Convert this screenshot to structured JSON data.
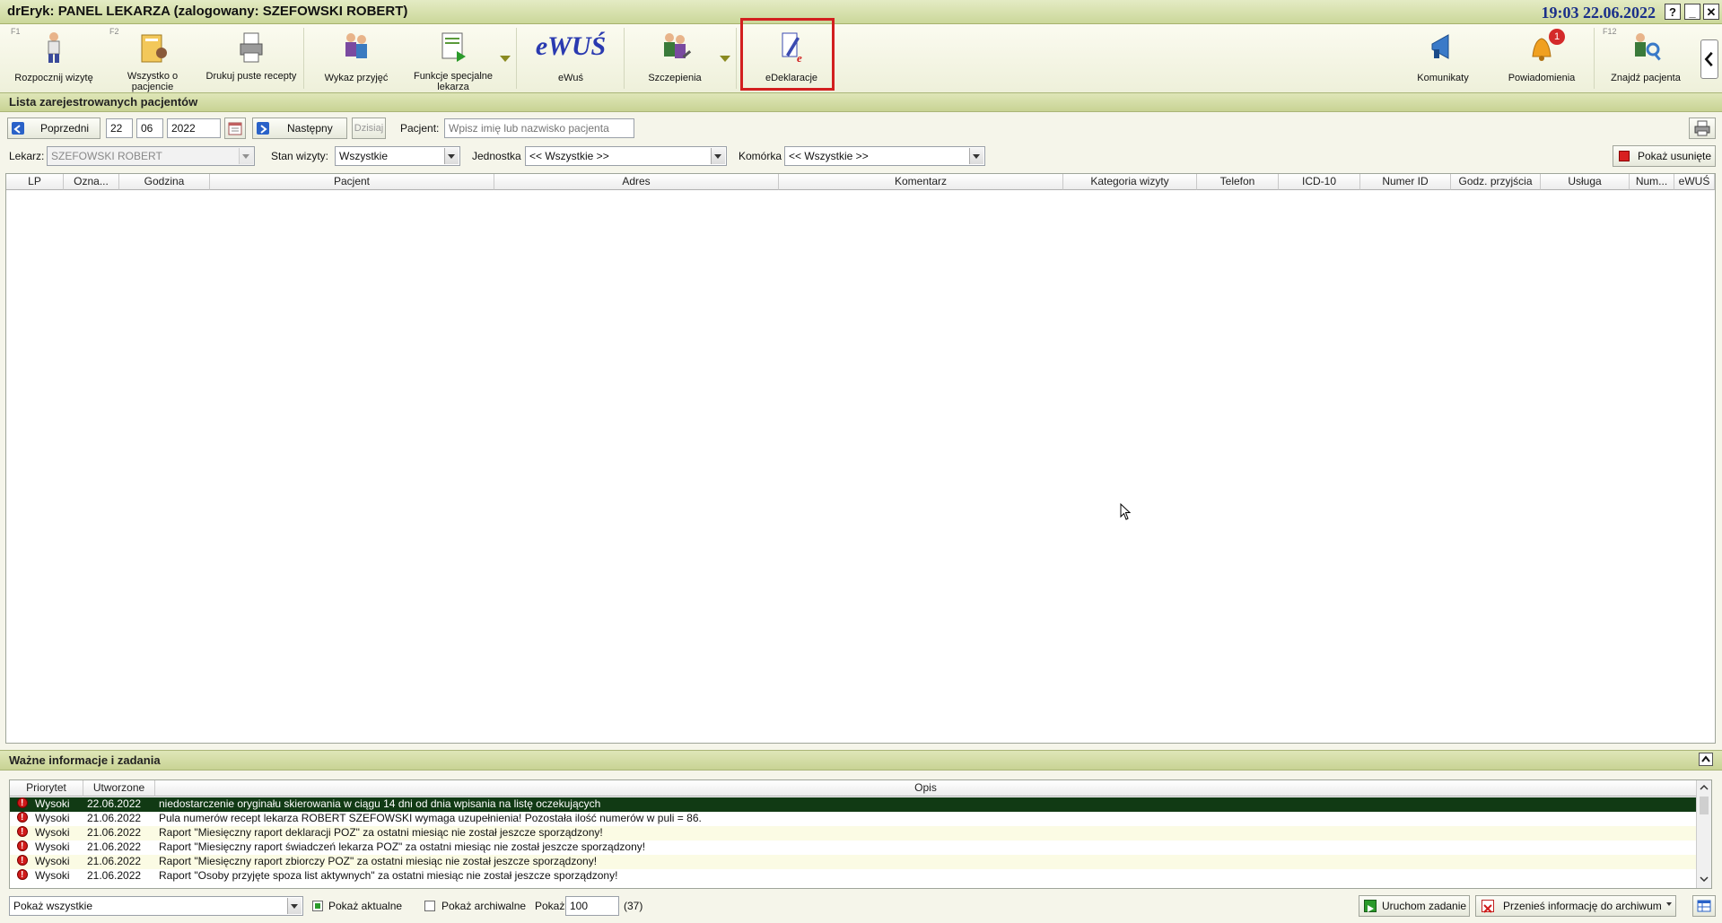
{
  "window": {
    "title": "drEryk: PANEL LEKARZA (zalogowany: SZEFOWSKI ROBERT)",
    "clock": "19:03 22.06.2022",
    "help_label": "?",
    "minimize_label": "_",
    "close_label": "✕"
  },
  "toolbar": {
    "start_visit": {
      "key": "F1",
      "label": "Rozpocznij wizytę"
    },
    "patient_info": {
      "key": "F2",
      "label": "Wszystko o pacjencie"
    },
    "print_blank": {
      "label": "Drukuj puste recepty"
    },
    "admissions": {
      "label": "Wykaz przyjęć"
    },
    "special_functions": {
      "label": "Funkcje specjalne lekarza"
    },
    "ewus": {
      "logo": "eWUŚ",
      "label": "eWuś"
    },
    "vaccinations": {
      "label": "Szczepienia"
    },
    "edeclarations": {
      "label": "eDeklaracje"
    },
    "messages": {
      "label": "Komunikaty"
    },
    "notifications": {
      "label": "Powiadomienia",
      "badge": "1"
    },
    "find_patient": {
      "key": "F12",
      "label": "Znajdź pacjenta"
    }
  },
  "patients_section": {
    "title": "Lista zarejestrowanych pacjentów",
    "prev_label": "Poprzedni",
    "day": "22",
    "month": "06",
    "year": "2022",
    "next_label": "Następny",
    "today_label": "Dzisiaj",
    "patient_label": "Pacjent:",
    "patient_placeholder": "Wpisz imię lub nazwisko pacjenta",
    "doctor_label": "Lekarz:",
    "doctor_value": "SZEFOWSKI ROBERT",
    "visit_state_label": "Stan wizyty:",
    "visit_state_value": "Wszystkie",
    "unit_label": "Jednostka",
    "unit_value": "<< Wszystkie >>",
    "cell_label": "Komórka",
    "cell_value": "<< Wszystkie >>",
    "show_deleted_label": "Pokaż usunięte",
    "columns": [
      "LP",
      "Ozna...",
      "Godzina",
      "Pacjent",
      "Adres",
      "Komentarz",
      "Kategoria wizyty",
      "Telefon",
      "ICD-10",
      "Numer ID",
      "Godz. przyjścia",
      "Usługa",
      "Num...",
      "eWUŚ"
    ]
  },
  "info_section": {
    "title": "Ważne informacje i zadania",
    "columns": [
      "Priorytet",
      "Utworzone",
      "Opis"
    ],
    "rows": [
      {
        "priority": "Wysoki",
        "created": "22.06.2022",
        "desc": "niedostarczenie oryginału skierowania w ciągu 14 dni od dnia wpisania na listę oczekujących"
      },
      {
        "priority": "Wysoki",
        "created": "21.06.2022",
        "desc": "Pula numerów recept lekarza ROBERT SZEFOWSKI wymaga uzupełnienia! Pozostała ilość numerów w puli = 86."
      },
      {
        "priority": "Wysoki",
        "created": "21.06.2022",
        "desc": "Raport \"Miesięczny raport deklaracji POZ\" za ostatni miesiąc nie został jeszcze sporządzony!"
      },
      {
        "priority": "Wysoki",
        "created": "21.06.2022",
        "desc": "Raport \"Miesięczny raport świadczeń lekarza POZ\" za ostatni miesiąc nie został jeszcze sporządzony!"
      },
      {
        "priority": "Wysoki",
        "created": "21.06.2022",
        "desc": "Raport \"Miesięczny raport zbiorczy POZ\" za ostatni miesiąc nie został jeszcze sporządzony!"
      },
      {
        "priority": "Wysoki",
        "created": "21.06.2022",
        "desc": "Raport \"Osoby przyjęte spoza list aktywnych\" za ostatni miesiąc nie został jeszcze sporządzony!"
      }
    ],
    "filter_value": "Pokaż wszystkie",
    "show_current_label": "Pokaż aktualne",
    "show_archived_label": "Pokaż archiwalne",
    "show_label": "Pokaż",
    "show_count": "100",
    "total": "(37)",
    "run_task_label": "Uruchom zadanie",
    "archive_label": "Przenieś informację do archiwum"
  },
  "colors": {
    "accent_green": "#c8d394",
    "selected_row": "#113a14",
    "highlight_border": "#d21f1f",
    "clock_blue": "#1a2f8a"
  }
}
